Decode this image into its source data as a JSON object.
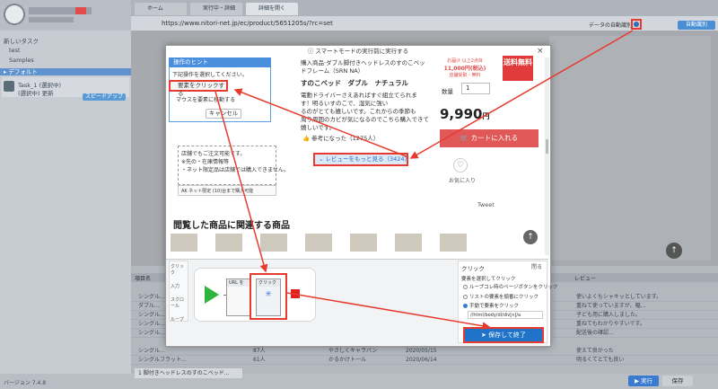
{
  "colors": {
    "accent": "#1f73c8",
    "annotation": "#e63b2e",
    "cart": "#e05858",
    "start": "#2fb53a",
    "stop": "#e02020"
  },
  "sidebar": {
    "section_new": "新しいタスク",
    "item_test": "test",
    "item_samples": "Samples",
    "selected": "▸ デフォルト",
    "task_name": "Task_1 (選択中)",
    "task_sub": "(選択中) 更新",
    "task_button": "スピードアップ"
  },
  "browser": {
    "tabs": [
      "ホーム",
      "実行中・詳細",
      "詳細を開く"
    ],
    "url": "https://www.nitori-net.jp/ec/product/5651205s/?rc=set",
    "detect_label": "自動識別",
    "smart_detect": "データの自動識別"
  },
  "modal": {
    "top_notice": "スマートモードの実行前に実行する",
    "hint_title": "操作のヒント",
    "hint_sub": "下記操作を選択してください。",
    "hint_opt_click": "要素をクリックする",
    "hint_opt_hover": "マウスを要素に移動する",
    "hint_cancel": "キャンセル",
    "card_lines": [
      "店舗でもご注文可能です。",
      "※先の・在庫情報等",
      "・ネット限定品は店舗では購入できません。"
    ],
    "card_small": "AK ネット限定 (10)台まで購入可能",
    "product_lines": [
      "購入商品·ダブル脚付きヘッドレスのすのこベッ",
      "ドフレーム（SRN NA）"
    ],
    "product_title": "すのこベッド　ダブル　ナチュラル",
    "product_desc": [
      "電動ドライバーさえあればすぐ組立てられま",
      "す！明るいすのこで、湿気に強い",
      "るのがとても嬉しいです。これからの季節も",
      "周り周囲のカビが気になるのでこちら購入できて",
      "嬉しいです。"
    ],
    "helpful": "参考になった（1275人）",
    "review_more": "レビューをもっと見る（3424）",
    "sale_line1": "お届け 以上2点目",
    "sale_line2": "11,000円(税込)",
    "sale_line3": "店舗受取・無料",
    "sale_badge": "送料無料",
    "qty_label": "数量",
    "qty_value": "1",
    "price": "9,990",
    "price_unit": "円",
    "cart_label": "カートに入れる",
    "fav_label": "お気に入り",
    "tweet": "Tweet",
    "related_title": "閲覧した商品に関連する商品",
    "up_icon": "↑"
  },
  "workflow": {
    "tools": [
      "クリック",
      "入力",
      "スクロール",
      "ループ"
    ],
    "node_url": "URL を",
    "node_click": "クリック",
    "panel_title": "クリック",
    "panel_q": "要素を選択してクリック",
    "option1": "ループコレ時のページボタンをクリック",
    "option2": "リストの要素を順番にクリック",
    "option3": "手動で要素をクリック",
    "xpath": "//html/body/dl/div[n]/a",
    "save_label": "保存して終了",
    "close_label": "閉る"
  },
  "bottom": {
    "header": [
      "項目名",
      "商品",
      "価格",
      "日付",
      "",
      "レビュー"
    ],
    "rows": [
      [
        "1",
        "シングル...",
        "",
        "",
        "",
        "使いよくもシャキッとしています。"
      ],
      [
        "2",
        "ダブル...",
        "",
        "",
        "",
        "重ねて使っていますが、幅..."
      ],
      [
        "3",
        "シングル...",
        "",
        "",
        "",
        "子ども用に購入しました。"
      ],
      [
        "4",
        "シングル...",
        "",
        "",
        "",
        "重ねてもわかりやすいです。"
      ],
      [
        "5",
        "シングル...",
        "",
        "",
        "",
        "配送後の確認..."
      ],
      [
        "6",
        "シングル...",
        "87人",
        "やさしくキャラバン",
        "2020/05/15",
        "使えて良かった"
      ],
      [
        "7",
        "シングルフラット...",
        "61人",
        "かるかけトール",
        "2020/06/14",
        "明るくてとても良い"
      ]
    ],
    "status_tab": "1 脚付きヘッドレスのすのこベッド...",
    "run": "▶ 実行",
    "save": "保存",
    "version": "バージョン 7.4.8"
  }
}
